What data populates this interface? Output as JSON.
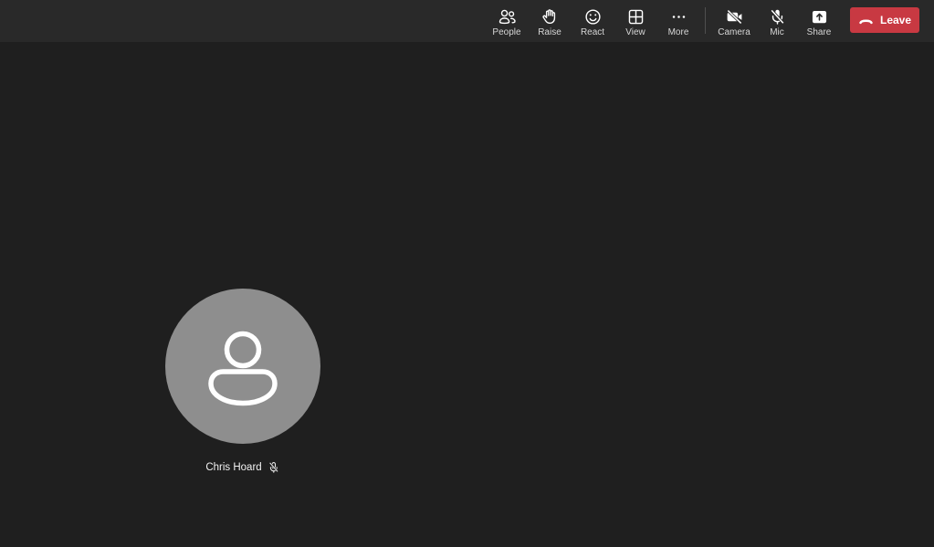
{
  "toolbar": {
    "buttons": [
      {
        "label": "People"
      },
      {
        "label": "Raise"
      },
      {
        "label": "React"
      },
      {
        "label": "View"
      },
      {
        "label": "More"
      },
      {
        "label": "Camera"
      },
      {
        "label": "Mic"
      },
      {
        "label": "Share"
      }
    ],
    "leave": {
      "label": "Leave"
    }
  },
  "stage": {
    "participant": {
      "name": "Chris Hoard",
      "mic_muted": true,
      "camera_off": true
    }
  },
  "colors": {
    "toolbar_bg": "#292929",
    "stage_bg": "#1f1f1f",
    "avatar_bg": "#8e8e8e",
    "leave_red": "#c83942",
    "icon": "#ffffff",
    "label": "#d6d6d6",
    "divider": "#4f4f4f"
  }
}
